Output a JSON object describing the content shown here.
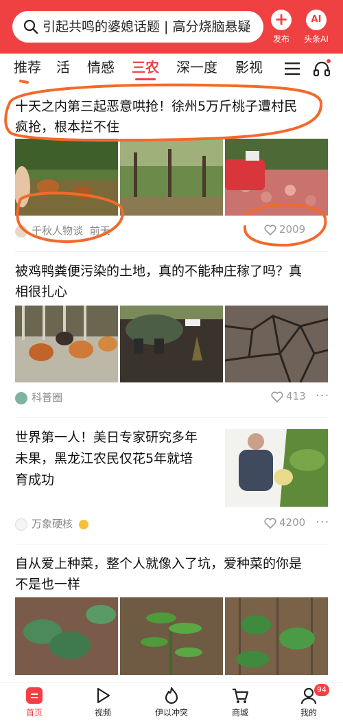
{
  "header": {
    "search_text": "引起共鸣的婆媳话题 | 高分烧脑悬疑",
    "publish_label": "发布",
    "ai_label": "头条AI",
    "ai_badge": "AI"
  },
  "tabs": {
    "items": [
      "推荐",
      "活",
      "情感",
      "三农",
      "深一度",
      "影视"
    ],
    "active": "三农"
  },
  "articles": [
    {
      "title_line1": "十天之内第三起恶意哄抢！徐州5万斤桃子遭村民",
      "title_line2": "疯抢，根本拦不住",
      "source": "千秋人物谈",
      "time": "前天",
      "likes": "2009"
    },
    {
      "title_line1": "被鸡鸭粪便污染的土地，真的不能种庄稼了吗？真",
      "title_line2": "相很扎心",
      "source": "科普圈",
      "likes": "413"
    },
    {
      "title_line1": "世界第一人！美日专家研究多年",
      "title_line2": "未果，黑龙江农民仅花5年就培",
      "title_line3": "育成功",
      "source": "万象硬核",
      "likes": "4200"
    },
    {
      "title_line1": "自从爱上种菜，整个人就像入了坑，爱种菜的你是",
      "title_line2": "不是也一样"
    }
  ],
  "bottom_nav": {
    "items": [
      "首页",
      "视频",
      "伊以冲突",
      "商城",
      "我的"
    ],
    "badge": "94"
  },
  "colors": {
    "brand": "#f04142",
    "annotation": "#f26a2b"
  }
}
